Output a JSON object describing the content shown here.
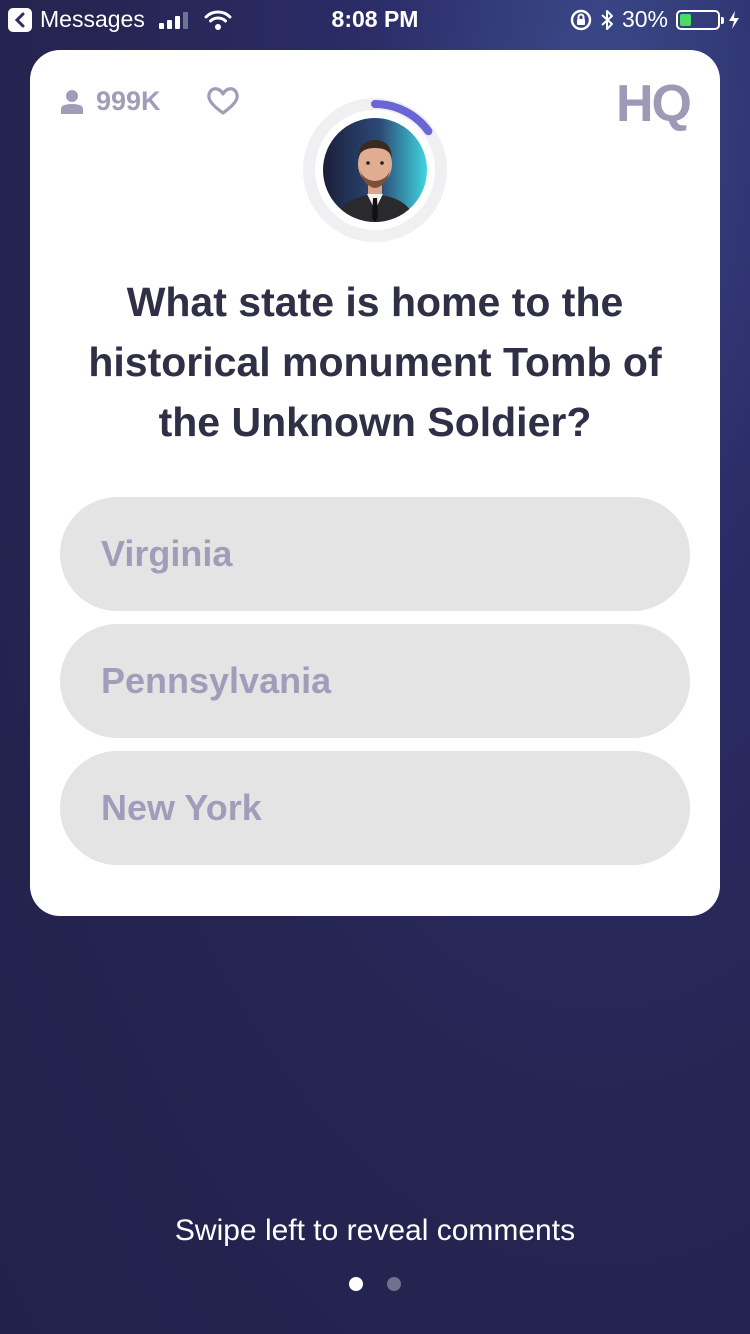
{
  "status_bar": {
    "back_app": "Messages",
    "time": "8:08 PM",
    "battery_percent": "30%",
    "battery_level": 0.3,
    "battery_color": "#4cd964"
  },
  "card": {
    "viewer_count": "999K",
    "logo": "HQ",
    "timer_remaining": 0.15,
    "timer_color": "#6b65d6",
    "question": "What state is home to the historical monument Tomb of the Unknown Soldier?",
    "answers": [
      {
        "label": "Virginia"
      },
      {
        "label": "Pennsylvania"
      },
      {
        "label": "New York"
      }
    ]
  },
  "footer": {
    "hint": "Swipe left to reveal comments",
    "pages": 2,
    "active_page": 1
  },
  "icons": [
    "back-icon",
    "signal-icon",
    "wifi-icon",
    "rotation-lock-icon",
    "bluetooth-icon",
    "battery-icon",
    "charging-icon",
    "person-icon",
    "heart-icon"
  ]
}
